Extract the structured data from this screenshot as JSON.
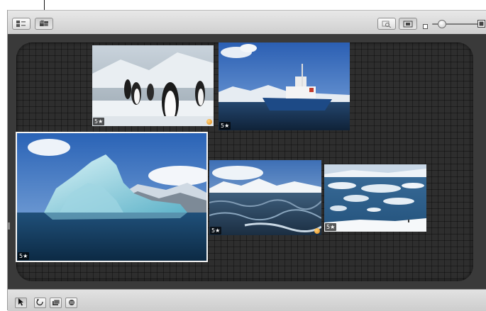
{
  "toolbar": {
    "left_buttons": [
      "view-options-icon",
      "lighttable-icon"
    ],
    "right_buttons": [
      "zoom-to-fit-icon",
      "show-all-icon"
    ],
    "zoom_slider": {
      "min_icon": "small-thumbnail-icon",
      "max_icon": "large-thumbnail-icon",
      "level": 0.15
    }
  },
  "photos": [
    {
      "id": "penguins",
      "subject": "penguins-on-snow",
      "rating": "5★",
      "flagged": true,
      "selected": false
    },
    {
      "id": "ship",
      "subject": "research-ship-at-sea",
      "rating": "5★",
      "flagged": false,
      "selected": false
    },
    {
      "id": "iceberg",
      "subject": "iceberg-in-bay",
      "rating": "5★",
      "flagged": false,
      "selected": true
    },
    {
      "id": "stormy-sea",
      "subject": "stormy-sea-mountains",
      "rating": "5★",
      "flagged": true,
      "selected": false
    },
    {
      "id": "ice-floes",
      "subject": "ice-floes-shore",
      "rating": "5★",
      "flagged": false,
      "selected": false
    }
  ],
  "bottom_tools": [
    "select-arrow-icon",
    "rotate-icon",
    "stack-icon",
    "lift-icon"
  ],
  "colors": {
    "canvas": "#2e2e2e",
    "selection": "#f4f4f4",
    "flag": "#e08a1a"
  }
}
